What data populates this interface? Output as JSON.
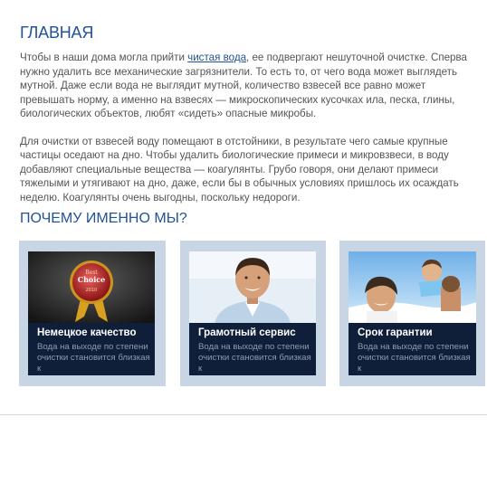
{
  "main": {
    "title": "ГЛАВНАЯ",
    "para1_pre": "Чтобы в наши дома могла прийти ",
    "para1_link": "чистая вода",
    "para1_post": ", ее подвергают нешуточной очистке. Сперва нужно удалить все механические загрязнители. То есть то, от чего вода может выглядеть мутной. Даже если вода не выглядит мутной, количество взвесей все равно может превышать норму, а именно на взвесях — микроскопических кусочках ила, песка, глины, биологических объектов, любят «сидеть» опасные микробы.",
    "para2": "Для очистки от взвесей воду помещают в отстойники, в результате чего самые крупные частицы оседают на дно. Чтобы удалить биологические примеси и микровзвеси, в воду добавляют специальные вещества — коагулянты. Грубо говоря, они делают примеси тяжелыми и утягивают на дно, даже, если бы в обычных условиях пришлось их осаждать неделю. Коагулянты очень выгодны, поскольку недороги."
  },
  "why": {
    "title": "ПОЧЕМУ ИМЕННО МЫ?",
    "cards": [
      {
        "title": "Немецкое качество",
        "text": "Вода на выходе по степени очистки становится близкая к",
        "badge_line1": "Best",
        "badge_line2": "Choice",
        "badge_year": "2010"
      },
      {
        "title": "Грамотный сервис",
        "text": "Вода на выходе по степени очистки становится близкая к"
      },
      {
        "title": "Срок гарантии",
        "text": "Вода на выходе по степени очистки становится близкая к"
      }
    ]
  },
  "colors": {
    "accent": "#1f5296",
    "card_bg": "#c7d5e5",
    "caption_bg": "#0f1f3a"
  }
}
